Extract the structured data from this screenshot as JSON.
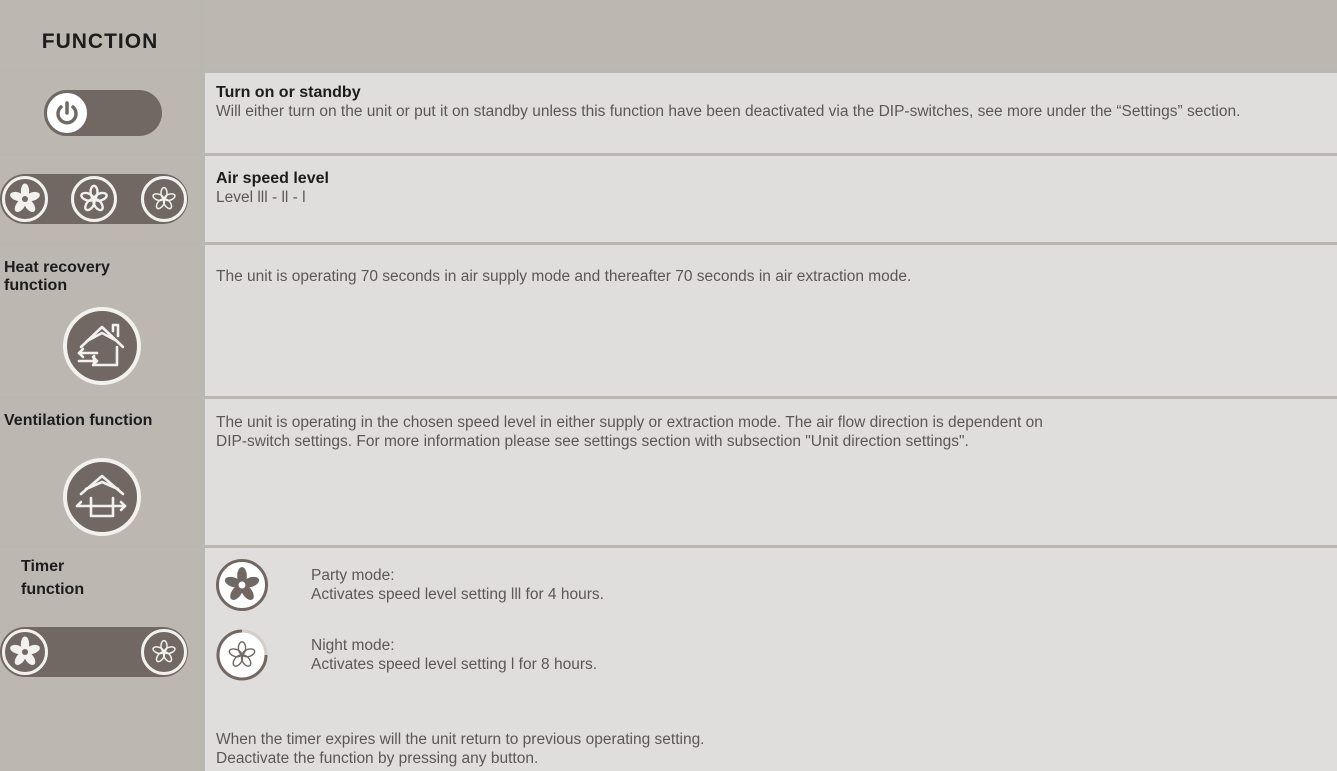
{
  "header": {
    "title": "FUNCTION"
  },
  "rows": {
    "power": {
      "icon": "power-icon",
      "title": "Turn on or standby",
      "desc": "Will either turn on the unit or put it on standby unless this function have been deactivated via the DIP-switches, see more under the “Settings” section."
    },
    "speed": {
      "icons": [
        "fan-speed-3-icon",
        "fan-speed-2-icon",
        "fan-speed-1-icon"
      ],
      "title": "Air speed level",
      "desc": "Level lll - ll - l"
    },
    "heat": {
      "label": "Heat recovery function",
      "icon": "heat-recovery-icon",
      "desc": "The unit is operating 70 seconds in air supply mode and thereafter 70 seconds in air extraction mode."
    },
    "vent": {
      "label": "Ventilation function",
      "icon": "ventilation-icon",
      "desc_line1": "The unit is operating in the chosen speed level in either supply or extraction mode. The air flow direction is dependent on",
      "desc_line2": "DIP-switch settings. For more information please see settings section with subsection \"Unit direction settings\"."
    },
    "timer": {
      "label_line1": "Timer",
      "label_line2": "function",
      "icons": [
        "party-mode-fan-icon",
        "night-mode-fan-icon"
      ],
      "party_title": "Party mode:",
      "party_desc": "Activates speed level setting lll for 4 hours.",
      "night_title": "Night mode:",
      "night_desc": "Activates speed level setting l for 8 hours.",
      "footer_line1": "When the timer expires will the unit return to previous operating setting.",
      "footer_line2": "Deactivate the function by pressing any button."
    }
  },
  "colors": {
    "left_column": "#bcb7b1",
    "right_column": "#e0dedc",
    "button_dark": "#716864",
    "button_ring": "#f3f1ee"
  }
}
